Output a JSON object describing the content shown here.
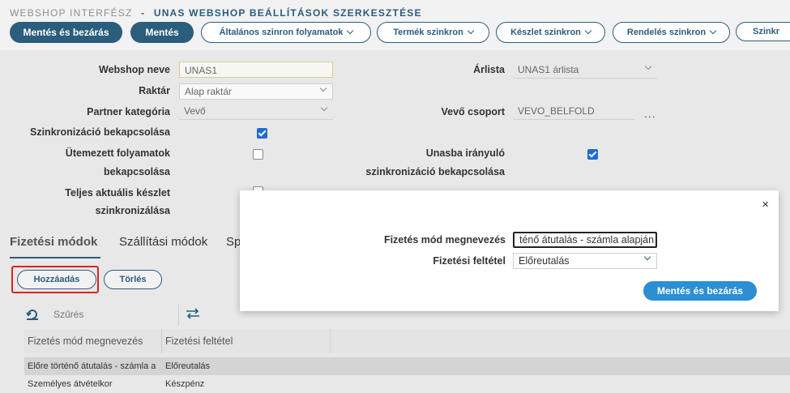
{
  "header": {
    "crumb": "WEBSHOP INTERFÉSZ",
    "separator": "-",
    "page_title": "UNAS WEBSHOP BEÁLLÍTÁSOK SZERKESZTÉSE"
  },
  "toolbar": {
    "save_close_label": "Mentés és bezárás",
    "save_label": "Mentés",
    "dropdowns": [
      "Általános szinron folyamatok",
      "Termék szinkron",
      "Készlet szinkron",
      "Rendelés szinkron",
      "Szinkr"
    ]
  },
  "form": {
    "webshop_name_label": "Webshop neve",
    "webshop_name_value": "UNAS1",
    "warehouse_label": "Raktár",
    "warehouse_value": "Alap raktár",
    "partner_category_label": "Partner kategória",
    "partner_category_value": "Vevő",
    "sync_enable_label": "Szinkronizáció bekapcsolása",
    "scheduled_label_1": "Ütemezett folyamatok",
    "scheduled_label_2": "bekapcsolása",
    "full_stock_label_1": "Teljes aktuális készlet",
    "full_stock_label_2": "szinkronizálása",
    "pricelist_label": "Árlista",
    "pricelist_value": "UNAS1 árlista",
    "customer_group_label": "Vevő csoport",
    "customer_group_value": "VEVO_BELFOLD",
    "customer_group_more": "...",
    "unas_sync_label_1": "Unasba irányuló",
    "unas_sync_label_2": "szinkronizáció bekapcsolása",
    "sync_enabled": true,
    "scheduled_enabled": false,
    "unas_sync_enabled": true
  },
  "tabs": [
    "Fizetési módok",
    "Szállítási módok",
    "Sp"
  ],
  "actions": {
    "add_label": "Hozzáadás",
    "delete_label": "Törlés"
  },
  "grid": {
    "filter_label": "Szűrés",
    "columns": [
      "Fizetés mód megnevezés",
      "Fizetési feltétel"
    ],
    "rows": [
      [
        "Előre történő átutalás - számla a",
        "Előreutalás"
      ],
      [
        "Személyes átvételkor",
        "Készpénz"
      ]
    ]
  },
  "modal": {
    "close_symbol": "×",
    "name_label": "Fizetés mód megnevezés",
    "name_value": "ténő átutalás - számla alapján",
    "condition_label": "Fizetési feltétel",
    "condition_value": "Előreutalás",
    "save_close_label": "Mentés és bezárás"
  },
  "colors": {
    "primary": "#2b5d7d",
    "modal_button": "#2c8ed3",
    "highlight": "#e02020"
  }
}
